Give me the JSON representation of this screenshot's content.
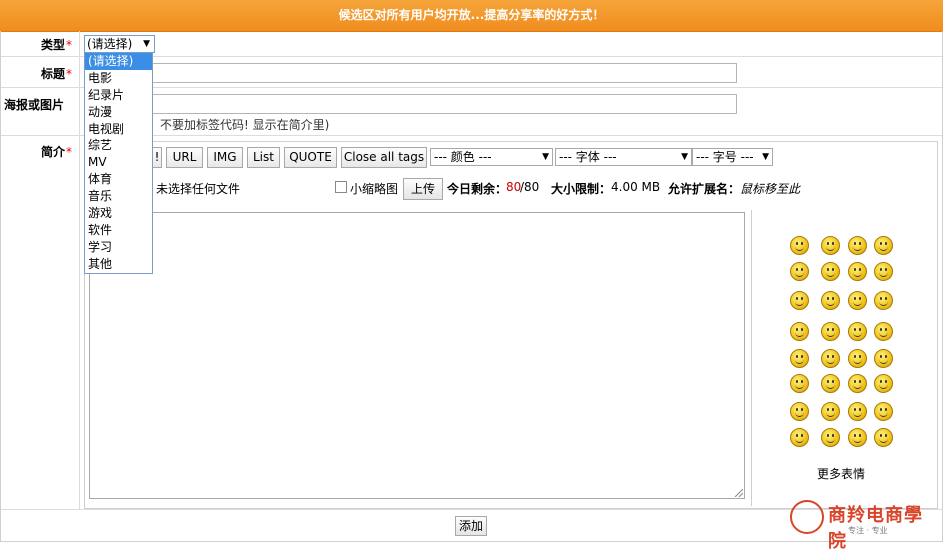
{
  "banner": "候选区对所有用户均开放...提高分享率的好方式！",
  "fields": {
    "type_label": "类型",
    "title_label": "标题",
    "poster_label": "海报或图片",
    "intro_label": "简介",
    "required_mark": "*"
  },
  "type_select": {
    "value": "(请选择)",
    "options": [
      "(请选择)",
      "电影",
      "纪录片",
      "动漫",
      "电视剧",
      "综艺",
      "MV",
      "体育",
      "音乐",
      "游戏",
      "软件",
      "学习",
      "其他"
    ]
  },
  "poster_hint": "不要加标签代码! 显示在简介里)",
  "toolbar": {
    "partial_btn": "!",
    "url": "URL",
    "img": "IMG",
    "list": "List",
    "quote": "QUOTE",
    "close_tags": "Close all tags",
    "color_select": "--- 颜色 ---",
    "font_select": "--- 字体 ---",
    "size_select": "--- 字号 ---"
  },
  "upload": {
    "no_file": "未选择任何文件",
    "thumbnail_label": "小缩略图",
    "upload_btn": "上传",
    "today_left_label": "今日剩余：",
    "today_left_value": "80",
    "today_left_total": "/80",
    "size_limit_label": "大小限制：",
    "size_limit_value": "4.00 MB",
    "ext_label": "允许扩展名：",
    "ext_value": "鼠标移至此"
  },
  "smilies": {
    "more": "更多表情"
  },
  "submit": "添加",
  "logo": {
    "brand": "商羚电商學院",
    "tagline": "专注 · 专业"
  },
  "colors": {
    "banner": "#f39a2a",
    "required": "#ee0000",
    "highlight": "#3a8ee6",
    "count": "#cc0000",
    "logo": "#d8452a"
  }
}
